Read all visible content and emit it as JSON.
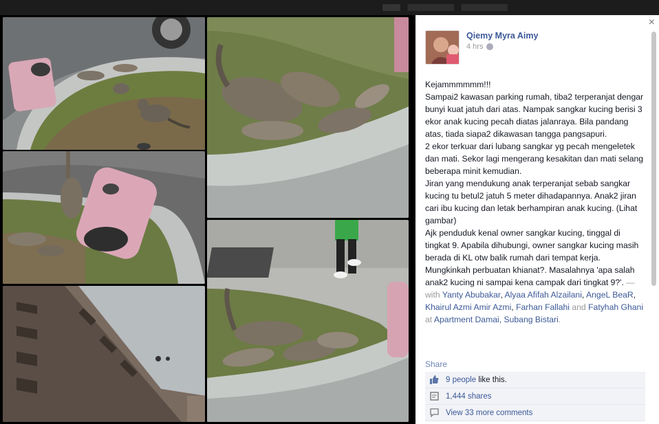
{
  "author": {
    "name": "Qiemy Myra Aimy",
    "time": "4 hrs"
  },
  "post": {
    "lines": [
      "Kejammmmmm!!!",
      "Sampai2 kawasan parking rumah, tiba2 terperanjat dengar bunyi kuat jatuh dari atas. Nampak sangkar kucing berisi 3 ekor anak kucing pecah diatas jalanraya. Bila pandang atas, tiada siapa2 dikawasan tangga pangsapuri.",
      "2 ekor terkuar dari lubang sangkar yg pecah mengeletek dan mati. Sekor lagi mengerang kesakitan dan mati selang beberapa minit kemudian.",
      "Jiran yang mendukung anak terperanjat sebab sangkar kucing tu betul2 jatuh 5 meter dihadapannya. Anak2 jiran cari ibu kucing dan letak berhampiran anak kucing. (Lihat gambar)",
      "Ajk penduduk kenal owner sangkar kucing, tinggal di tingkat 9. Apabila dihubungi, owner sangkar kucing masih berada di KL otw balik rumah dari tempat kerja. Mungkinkah perbuatan khianat?. Masalahnya 'apa salah anak2 kucing ni sampai kena campak dari tingkat 9?'."
    ],
    "with_label": " — with ",
    "tags": [
      "Yanty Abubakar",
      "Alyaa Afifah Alzailani",
      "AngeL BeaR",
      "Khairul Azmi Amir Azmi",
      "Farhan Fallahi"
    ],
    "and_label": " and ",
    "last_tag": "Fatyhah Ghani",
    "at_label": " at ",
    "place": "Apartment Damai, Subang Bistari",
    "period": "."
  },
  "actions": {
    "share": "Share",
    "close": "×"
  },
  "stats": {
    "likes_link": "9 people",
    "likes_rest": " like this.",
    "shares": "1,444 shares",
    "comments": "View 33 more comments"
  },
  "colors": {
    "link": "#3b5998",
    "background": "#0e0e0e"
  }
}
